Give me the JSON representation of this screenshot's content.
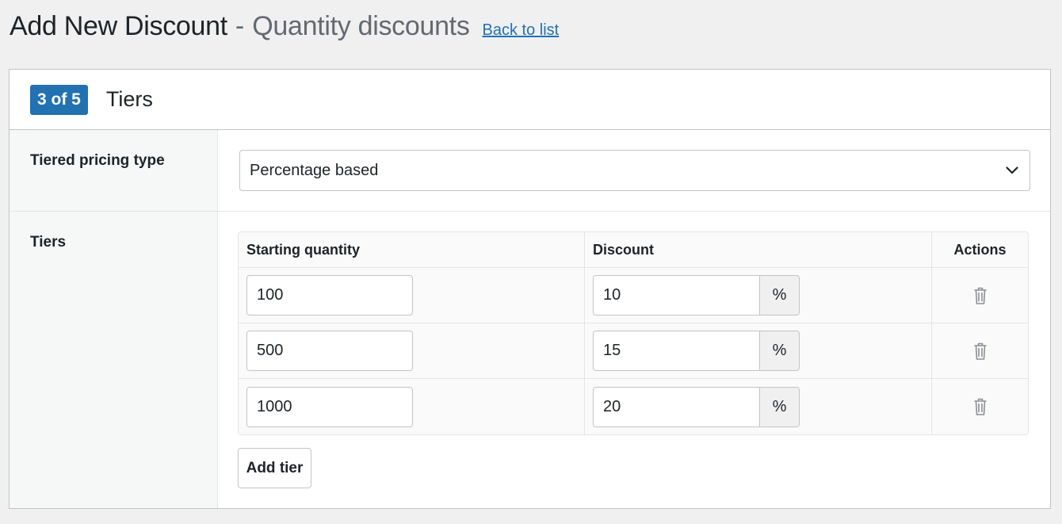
{
  "header": {
    "title": "Add New Discount",
    "separator": "-",
    "subtitle": "Quantity discounts",
    "back_link": "Back to list"
  },
  "panel": {
    "step_badge": "3 of 5",
    "title": "Tiers"
  },
  "pricing_type": {
    "label": "Tiered pricing type",
    "selected": "Percentage based"
  },
  "tiers": {
    "label": "Tiers",
    "columns": [
      "Starting quantity",
      "Discount",
      "Actions"
    ],
    "rows": [
      {
        "quantity": "100",
        "discount": "10",
        "unit": "%"
      },
      {
        "quantity": "500",
        "discount": "15",
        "unit": "%"
      },
      {
        "quantity": "1000",
        "discount": "20",
        "unit": "%"
      }
    ],
    "add_button": "Add tier"
  },
  "colors": {
    "accent": "#2271b1",
    "background": "#f0f0f1",
    "border": "#c3c4c7"
  },
  "icons": {
    "select": "chevron-down-icon",
    "delete": "trash-icon"
  }
}
